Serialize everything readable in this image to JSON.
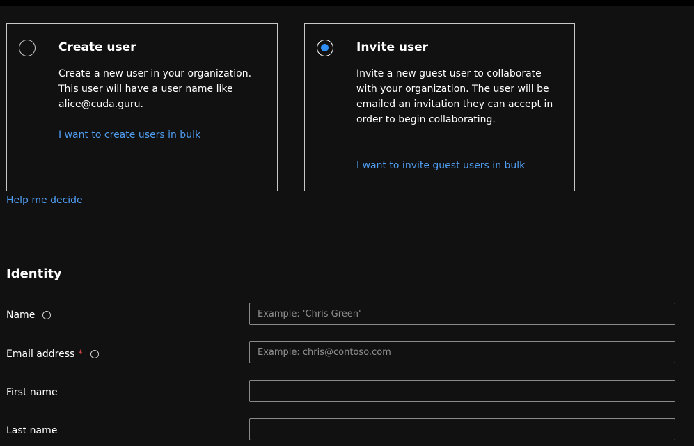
{
  "options": {
    "create": {
      "title": "Create user",
      "description": "Create a new user in your organization. This user will have a user name like alice@cuda.guru.",
      "link": "I want to create users in bulk",
      "selected": false
    },
    "invite": {
      "title": "Invite user",
      "description": "Invite a new guest user to collaborate with your organization. The user will be emailed an invitation they can accept in order to begin collaborating.",
      "link": "I want to invite guest users in bulk",
      "selected": true
    }
  },
  "help_link": "Help me decide",
  "identity": {
    "title": "Identity",
    "fields": {
      "name": {
        "label": "Name",
        "placeholder": "Example: 'Chris Green'",
        "value": ""
      },
      "email": {
        "label": "Email address",
        "required_mark": "*",
        "placeholder": "Example: chris@contoso.com",
        "value": ""
      },
      "first_name": {
        "label": "First name",
        "placeholder": "",
        "value": ""
      },
      "last_name": {
        "label": "Last name",
        "placeholder": "",
        "value": ""
      }
    }
  },
  "colors": {
    "background": "#111111",
    "link": "#4f9cf0",
    "radio_selected": "#2f8ff5",
    "required": "#e34a4a"
  },
  "icons": {
    "info": "info-circle-icon"
  }
}
